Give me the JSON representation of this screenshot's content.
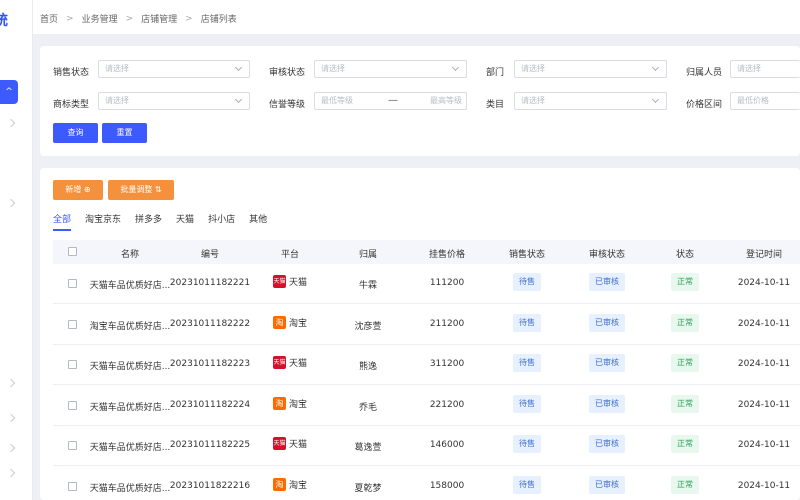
{
  "app": {
    "title_fragment": "统"
  },
  "breadcrumb": [
    "首页",
    "业务管理",
    "店铺管理",
    "店铺列表"
  ],
  "filters": {
    "sales_status": {
      "label": "销售状态",
      "placeholder": "请选择"
    },
    "review_status": {
      "label": "审核状态",
      "placeholder": "请选择"
    },
    "department": {
      "label": "部门",
      "placeholder": "请选择"
    },
    "owner": {
      "label": "归属人员",
      "placeholder": "请选择"
    },
    "trademark_type": {
      "label": "商标类型",
      "placeholder": "请选择"
    },
    "credit_level": {
      "label": "信誉等级",
      "min_placeholder": "最低等级",
      "sep": "—",
      "max_placeholder": "最高等级"
    },
    "category": {
      "label": "类目",
      "placeholder": "请选择"
    },
    "price_range": {
      "label": "价格区间",
      "placeholder": "最低价格"
    },
    "query_label": "查询",
    "reset_label": "重置"
  },
  "toolbar": {
    "add_label": "新增",
    "batch_label": "批量调整"
  },
  "tabs": [
    "全部",
    "淘宝京东",
    "拼多多",
    "天猫",
    "抖小店",
    "其他"
  ],
  "table": {
    "columns": [
      "名称",
      "编号",
      "平台",
      "归属",
      "挂售价格",
      "销售状态",
      "审核状态",
      "状态",
      "登记时间"
    ],
    "rows": [
      {
        "name": "天猫车品优质好店...",
        "id": "20231011182221",
        "platform": "天猫",
        "platform_icon": "天猫",
        "owner": "牛霖",
        "price": "111200",
        "sales": "待售",
        "review": "已审核",
        "status": "正常",
        "date": "2024-10-11"
      },
      {
        "name": "淘宝车品优质好店...",
        "id": "20231011182222",
        "platform": "淘宝",
        "platform_icon": "淘",
        "owner": "沈彦萱",
        "price": "211200",
        "sales": "待售",
        "review": "已审核",
        "status": "正常",
        "date": "2024-10-11"
      },
      {
        "name": "天猫车品优质好店...",
        "id": "20231011182223",
        "platform": "天猫",
        "platform_icon": "天猫",
        "owner": "熊逸",
        "price": "311200",
        "sales": "待售",
        "review": "已审核",
        "status": "正常",
        "date": "2024-10-11"
      },
      {
        "name": "天猫车品优质好店...",
        "id": "20231011182224",
        "platform": "淘宝",
        "platform_icon": "淘",
        "owner": "乔毛",
        "price": "221200",
        "sales": "待售",
        "review": "已审核",
        "status": "正常",
        "date": "2024-10-11"
      },
      {
        "name": "天猫车品优质好店...",
        "id": "20231011182225",
        "platform": "天猫",
        "platform_icon": "天猫",
        "owner": "葛逸萱",
        "price": "146000",
        "sales": "待售",
        "review": "已审核",
        "status": "正常",
        "date": "2024-10-11"
      },
      {
        "name": "天猫车品优质好店...",
        "id": "20231011822216",
        "platform": "淘宝",
        "platform_icon": "淘",
        "owner": "夏乾梦",
        "price": "158000",
        "sales": "待售",
        "review": "已审核",
        "status": "正常",
        "date": "2024-10-11"
      }
    ]
  }
}
